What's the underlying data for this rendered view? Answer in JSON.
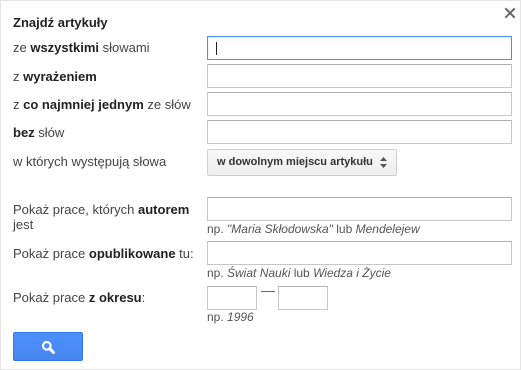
{
  "dialog": {
    "title": "Znajdź artykuły",
    "close_symbol": "×"
  },
  "fields": {
    "all_words": {
      "pre": "ze ",
      "bold": "wszystkimi",
      "post": " słowami",
      "value": ""
    },
    "exact_phrase": {
      "pre": "z ",
      "bold": "wyrażeniem",
      "post": "",
      "value": ""
    },
    "at_least_one": {
      "pre": "z ",
      "bold": "co najmniej jednym",
      "post": " ze słów",
      "value": ""
    },
    "without": {
      "pre": "",
      "bold": "bez",
      "post": " słów",
      "value": ""
    },
    "occurrence": {
      "label": "w których występują słowa",
      "selected": "w dowolnym miejscu artykułu"
    },
    "author": {
      "line1_pre": "Pokaż prace, których ",
      "line1_bold": "autorem",
      "line2": "jest",
      "value": "",
      "hint_pre": "np. ",
      "hint_i1": "\"Maria Skłodowska\"",
      "hint_mid": " lub ",
      "hint_i2": "Mendelejew"
    },
    "publication": {
      "pre": "Pokaż prace ",
      "bold": "opublikowane",
      "post": " tu:",
      "value": "",
      "hint_pre": "np. ",
      "hint_i1": "Świat Nauki",
      "hint_mid": " lub ",
      "hint_i2": "Wiedza i Życie"
    },
    "period": {
      "pre": "Pokaż prace ",
      "bold": "z okresu",
      "post": ":",
      "from": "",
      "to": "",
      "hint_pre": "np. ",
      "hint_i1": "1996"
    }
  },
  "search_button": {
    "icon": "search-icon",
    "color": "#4d90fe"
  }
}
